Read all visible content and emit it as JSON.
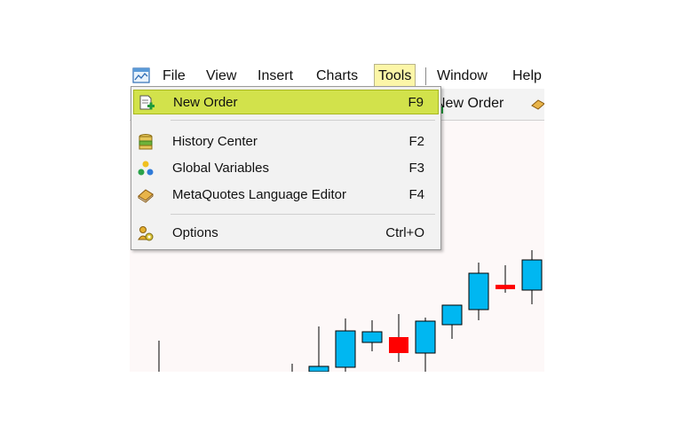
{
  "menubar": {
    "items": [
      {
        "label": "File"
      },
      {
        "label": "View"
      },
      {
        "label": "Insert"
      },
      {
        "label": "Charts"
      },
      {
        "label": "Tools"
      },
      {
        "label": "Window"
      },
      {
        "label": "Help"
      }
    ],
    "active": "Tools"
  },
  "toolbar": {
    "new_order_label": "New Order"
  },
  "tools_menu": {
    "items": [
      {
        "label": "New Order",
        "shortcut": "F9",
        "icon": "new-order-icon"
      },
      {
        "label": "History Center",
        "shortcut": "F2",
        "icon": "database-icon"
      },
      {
        "label": "Global Variables",
        "shortcut": "F3",
        "icon": "variables-icon"
      },
      {
        "label": "MetaQuotes Language Editor",
        "shortcut": "F4",
        "icon": "editor-book-icon"
      },
      {
        "label": "Options",
        "shortcut": "Ctrl+O",
        "icon": "options-gear-icon"
      }
    ]
  },
  "colors": {
    "highlight": "#d2e24b",
    "bull_candle": "#00b7f1",
    "bear_candle": "#ff0000"
  },
  "chart_data": {
    "type": "candlestick",
    "candles": [
      {
        "dir": "up"
      },
      {
        "dir": "up"
      },
      {
        "dir": "up"
      },
      {
        "dir": "up"
      },
      {
        "dir": "down"
      },
      {
        "dir": "up"
      },
      {
        "dir": "up"
      },
      {
        "dir": "up"
      },
      {
        "dir": "down"
      },
      {
        "dir": "up"
      }
    ]
  }
}
